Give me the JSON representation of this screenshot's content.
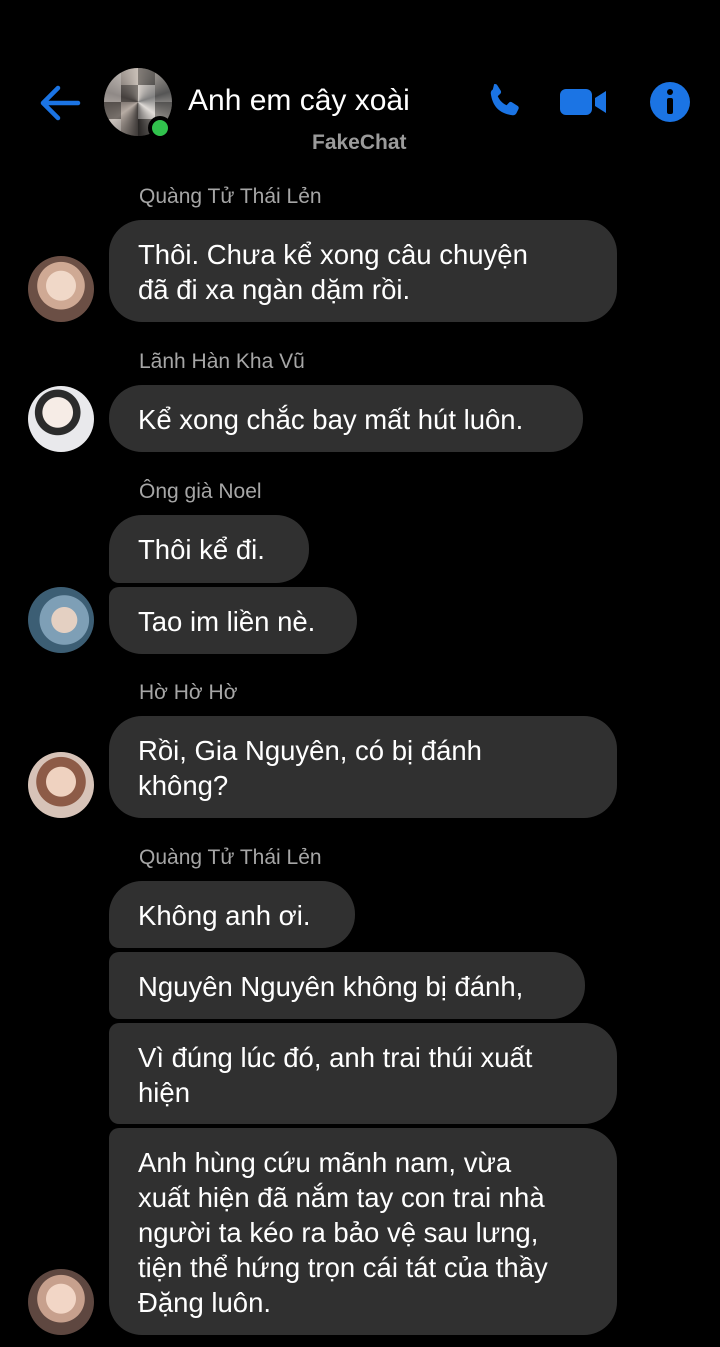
{
  "header": {
    "title": "Anh em cây xoài",
    "subtitle": "FakeChat",
    "accent_color": "#1b74e4",
    "online_color": "#31c24d",
    "icons": [
      "back-arrow-icon",
      "phone-icon",
      "video-camera-icon",
      "info-icon"
    ]
  },
  "messages": {
    "sender_1": "Quàng Tử Thái Lẻn",
    "m1": "Thôi. Chưa kể xong câu chuyện\nđã đi xa ngàn dặm rồi.",
    "sender_2": "Lãnh Hàn Kha Vũ",
    "m2": "Kể xong chắc bay mất hút luôn.",
    "sender_3": "Ông già Noel",
    "m3": "Thôi kể đi.",
    "m4": "Tao im liền nè.",
    "sender_4": "Hờ Hờ Hờ",
    "m5": "Rồi, Gia Nguyên, có bị đánh\nkhông?",
    "sender_5": "Quàng Tử Thái Lẻn",
    "m6": "Không anh ơi.",
    "m7": "Nguyên Nguyên không bị đánh,",
    "m8": "Vì đúng lúc đó, anh trai thúi xuất\nhiện",
    "m9": "Anh hùng cứu mãnh nam, vừa\nxuất hiện đã nắm tay con trai nhà\nngười ta kéo ra bảo vệ sau lưng,\ntiện thể hứng trọn cái tát của thầy\nĐặng luôn."
  }
}
